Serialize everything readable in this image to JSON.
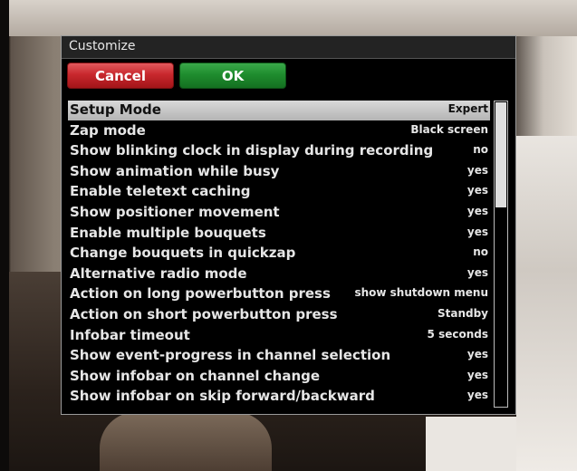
{
  "window": {
    "title": "Customize"
  },
  "buttons": {
    "cancel": "Cancel",
    "ok": "OK"
  },
  "settings": [
    {
      "label": "Setup Mode",
      "value": "Expert",
      "selected": true
    },
    {
      "label": "Zap mode",
      "value": "Black screen"
    },
    {
      "label": "Show blinking clock in display during recording",
      "value": "no"
    },
    {
      "label": "Show animation while busy",
      "value": "yes"
    },
    {
      "label": "Enable teletext caching",
      "value": "yes"
    },
    {
      "label": "Show positioner movement",
      "value": "yes"
    },
    {
      "label": "Enable multiple bouquets",
      "value": "yes"
    },
    {
      "label": "Change bouquets in quickzap",
      "value": "no"
    },
    {
      "label": "Alternative radio mode",
      "value": "yes"
    },
    {
      "label": "Action on long powerbutton press",
      "value": "show shutdown menu"
    },
    {
      "label": "Action on short powerbutton press",
      "value": "Standby"
    },
    {
      "label": "Infobar timeout",
      "value": "5 seconds"
    },
    {
      "label": "Show event-progress in channel selection",
      "value": "yes"
    },
    {
      "label": "Show infobar on channel change",
      "value": "yes"
    },
    {
      "label": "Show infobar on skip forward/backward",
      "value": "yes"
    }
  ],
  "colors": {
    "cancel": "#c8282d",
    "ok": "#1f8d2e",
    "selection": "#c8c8c8"
  }
}
